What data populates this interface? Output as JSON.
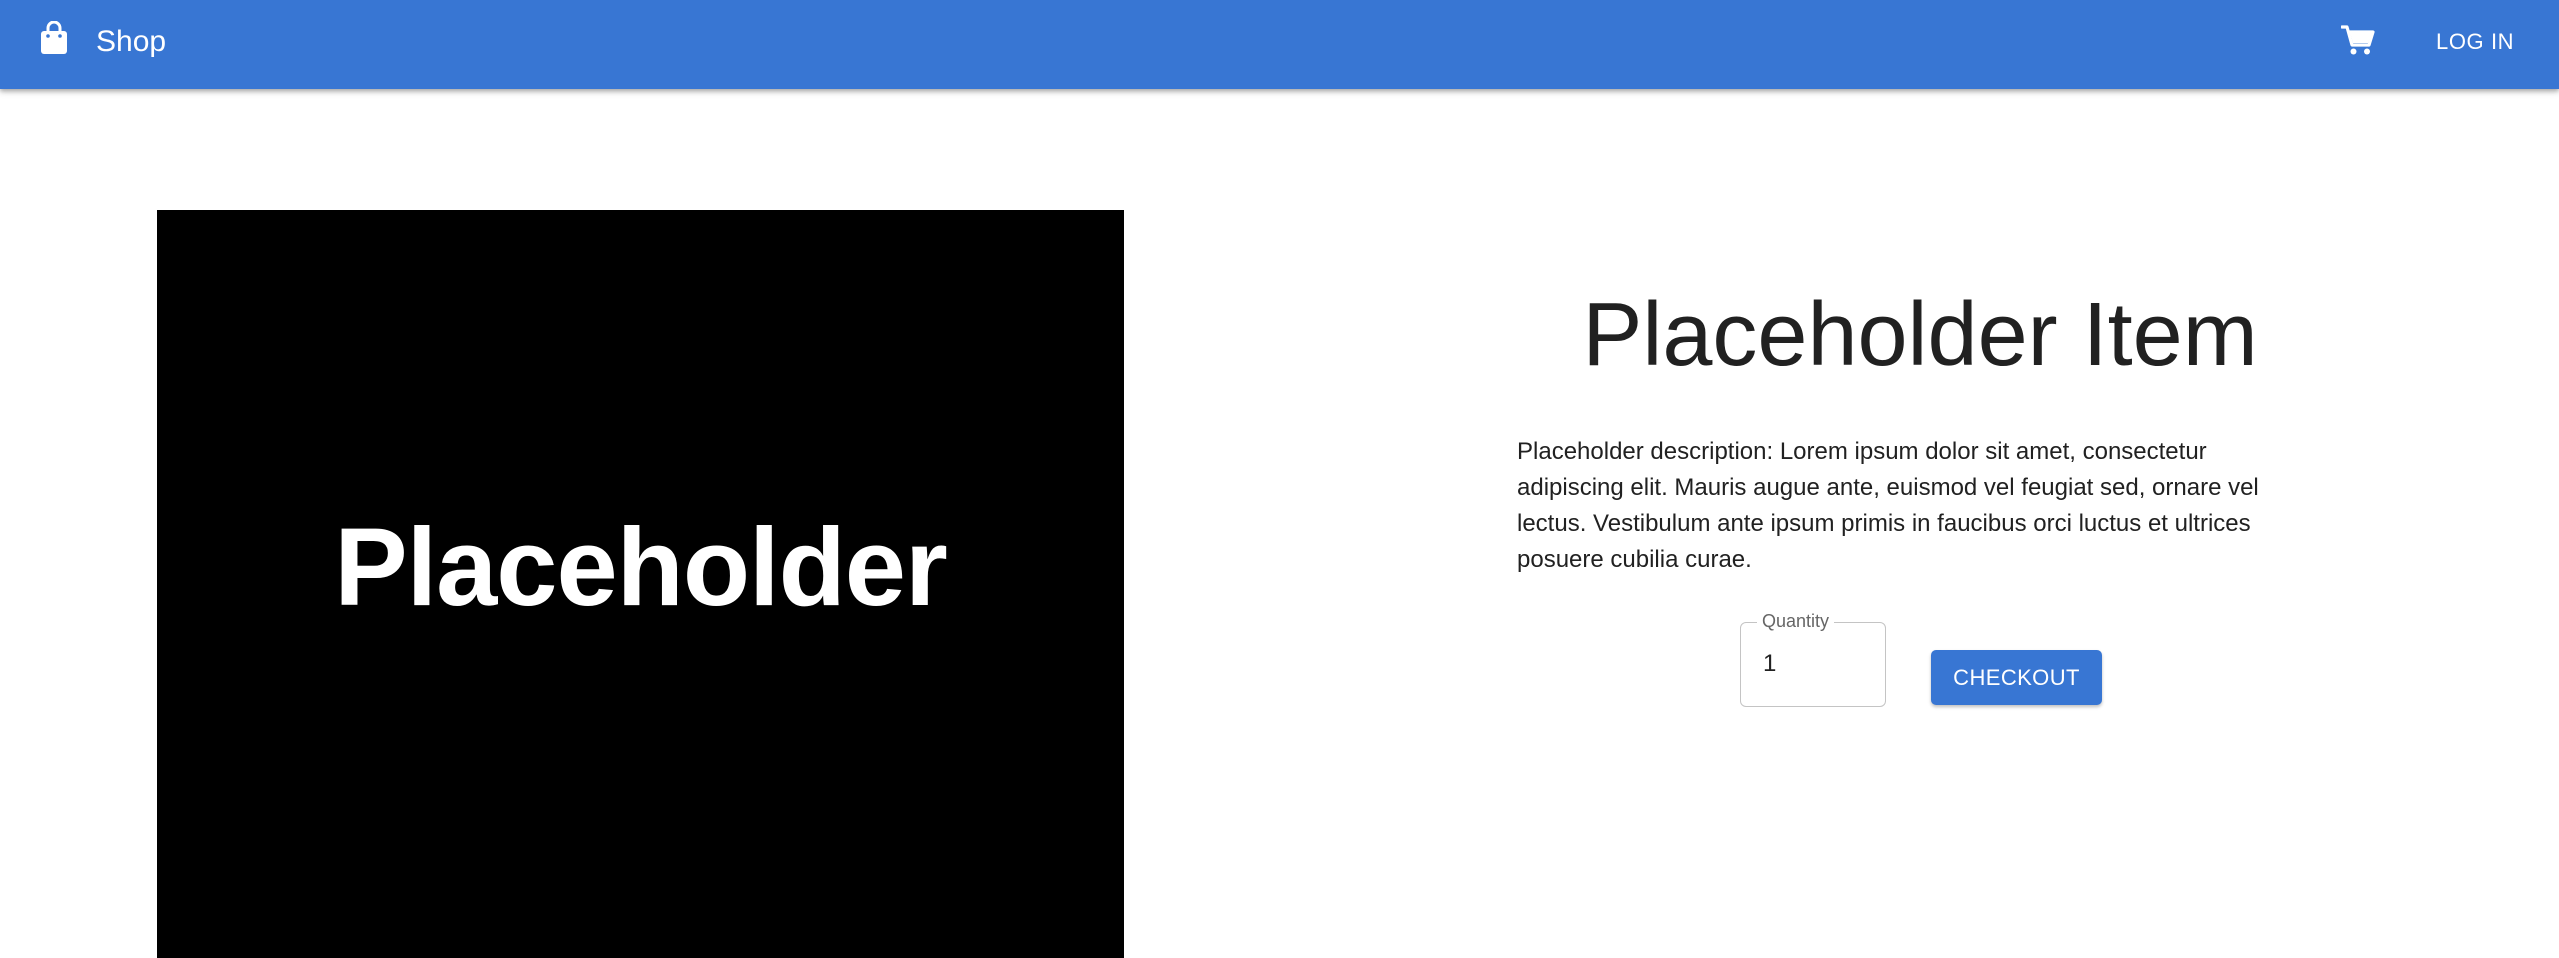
{
  "app_bar": {
    "background_color": "#3876d3",
    "brand_icon": "shopping-bag-icon",
    "brand_name": "Shop",
    "cart_icon": "shopping-cart-icon",
    "login_label": "LOG IN"
  },
  "product": {
    "image_text": "Placeholder",
    "title": "Placeholder Item",
    "description": "Placeholder description: Lorem ipsum dolor sit amet, consectetur adipiscing elit. Mauris augue ante, euismod vel feugiat sed, ornare vel lectus. Vestibulum ante ipsum primis in faucibus orci luctus et ultrices posuere cubilia curae.",
    "quantity": {
      "label": "Quantity",
      "value": "1"
    },
    "checkout_label": "CHECKOUT",
    "accent_color": "#3876d3"
  }
}
